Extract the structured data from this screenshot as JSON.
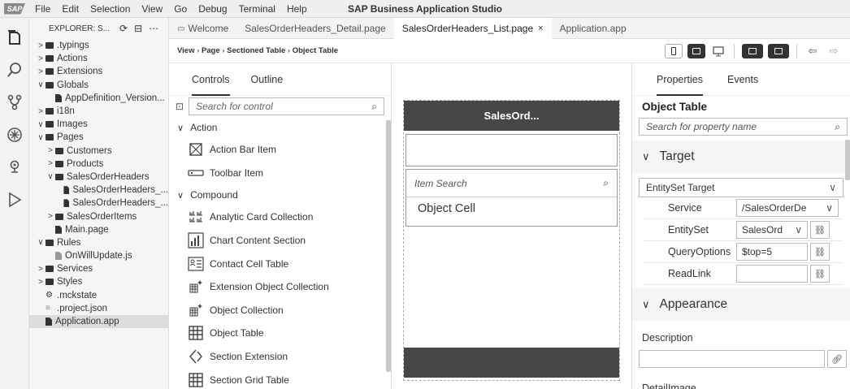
{
  "menu": {
    "logo": "SAP",
    "items": [
      "File",
      "Edit",
      "Selection",
      "View",
      "Go",
      "Debug",
      "Terminal",
      "Help"
    ],
    "app_title": "SAP Business Application Studio"
  },
  "explorer": {
    "title": "EXPLORER: S...",
    "tree": [
      {
        "label": ".typings",
        "type": "folder",
        "expanded": false,
        "indent": 0
      },
      {
        "label": "Actions",
        "type": "folder",
        "expanded": false,
        "indent": 0
      },
      {
        "label": "Extensions",
        "type": "folder",
        "expanded": false,
        "indent": 0
      },
      {
        "label": "Globals",
        "type": "folder",
        "expanded": true,
        "indent": 0
      },
      {
        "label": "AppDefinition_Version...",
        "type": "file",
        "indent": 1
      },
      {
        "label": "i18n",
        "type": "folder",
        "expanded": false,
        "indent": 0
      },
      {
        "label": "Images",
        "type": "folder",
        "expanded": true,
        "indent": 0
      },
      {
        "label": "Pages",
        "type": "folder",
        "expanded": true,
        "indent": 0
      },
      {
        "label": "Customers",
        "type": "folder",
        "expanded": false,
        "indent": 1
      },
      {
        "label": "Products",
        "type": "folder",
        "expanded": false,
        "indent": 1
      },
      {
        "label": "SalesOrderHeaders",
        "type": "folder",
        "expanded": true,
        "indent": 1
      },
      {
        "label": "SalesOrderHeaders_...",
        "type": "file",
        "indent": 2
      },
      {
        "label": "SalesOrderHeaders_...",
        "type": "file",
        "indent": 2
      },
      {
        "label": "SalesOrderItems",
        "type": "folder",
        "expanded": false,
        "indent": 1
      },
      {
        "label": "Main.page",
        "type": "file",
        "indent": 1
      },
      {
        "label": "Rules",
        "type": "folder",
        "expanded": true,
        "indent": 0
      },
      {
        "label": "OnWillUpdate.js",
        "type": "jsfile",
        "indent": 1
      },
      {
        "label": "Services",
        "type": "folder",
        "expanded": false,
        "indent": 0
      },
      {
        "label": "Styles",
        "type": "folder",
        "expanded": false,
        "indent": 0
      },
      {
        "label": ".mckstate",
        "type": "gear",
        "indent": 0
      },
      {
        "label": ".project.json",
        "type": "json",
        "indent": 0
      },
      {
        "label": "Application.app",
        "type": "file",
        "indent": 0,
        "selected": true
      }
    ]
  },
  "tabs": [
    {
      "label": "Welcome",
      "active": false
    },
    {
      "label": "SalesOrderHeaders_Detail.page",
      "active": false
    },
    {
      "label": "SalesOrderHeaders_List.page",
      "active": true,
      "close": "×"
    },
    {
      "label": "Application.app",
      "active": false
    }
  ],
  "breadcrumb": [
    "View",
    "Page",
    "Sectioned Table",
    "Object Table"
  ],
  "controls": {
    "tabs": [
      "Controls",
      "Outline"
    ],
    "search_placeholder": "Search for control",
    "groups": [
      {
        "label": "Action",
        "items": [
          {
            "label": "Action Bar Item",
            "icon": "action-bar-item-icon"
          },
          {
            "label": "Toolbar Item",
            "icon": "toolbar-item-icon"
          }
        ]
      },
      {
        "label": "Compound",
        "items": [
          {
            "label": "Analytic Card Collection",
            "icon": "analytic-card-icon"
          },
          {
            "label": "Chart Content Section",
            "icon": "chart-icon"
          },
          {
            "label": "Contact Cell Table",
            "icon": "contact-cell-icon"
          },
          {
            "label": "Extension Object Collection",
            "icon": "extension-object-icon"
          },
          {
            "label": "Object Collection",
            "icon": "object-collection-icon"
          },
          {
            "label": "Object Table",
            "icon": "object-table-icon"
          },
          {
            "label": "Section Extension",
            "icon": "section-extension-icon"
          },
          {
            "label": "Section Grid Table",
            "icon": "section-grid-icon"
          }
        ]
      }
    ]
  },
  "canvas": {
    "header_title": "SalesOrd...",
    "search_placeholder": "Item Search",
    "cell_label": "Object Cell"
  },
  "properties": {
    "tabs": [
      "Properties",
      "Events"
    ],
    "title": "Object Table",
    "search_placeholder": "Search for property name",
    "target_section": "Target",
    "target_select": "EntitySet Target",
    "rows": [
      {
        "label": "Service",
        "value": "/SalesOrderDe",
        "kind": "select"
      },
      {
        "label": "EntitySet",
        "value": "SalesOrd",
        "kind": "select-link"
      },
      {
        "label": "QueryOptions",
        "value": "$top=5",
        "kind": "text-link"
      },
      {
        "label": "ReadLink",
        "value": "",
        "kind": "text-link"
      }
    ],
    "appearance_section": "Appearance",
    "description_label": "Description",
    "detail_image_label": "DetailImage"
  }
}
